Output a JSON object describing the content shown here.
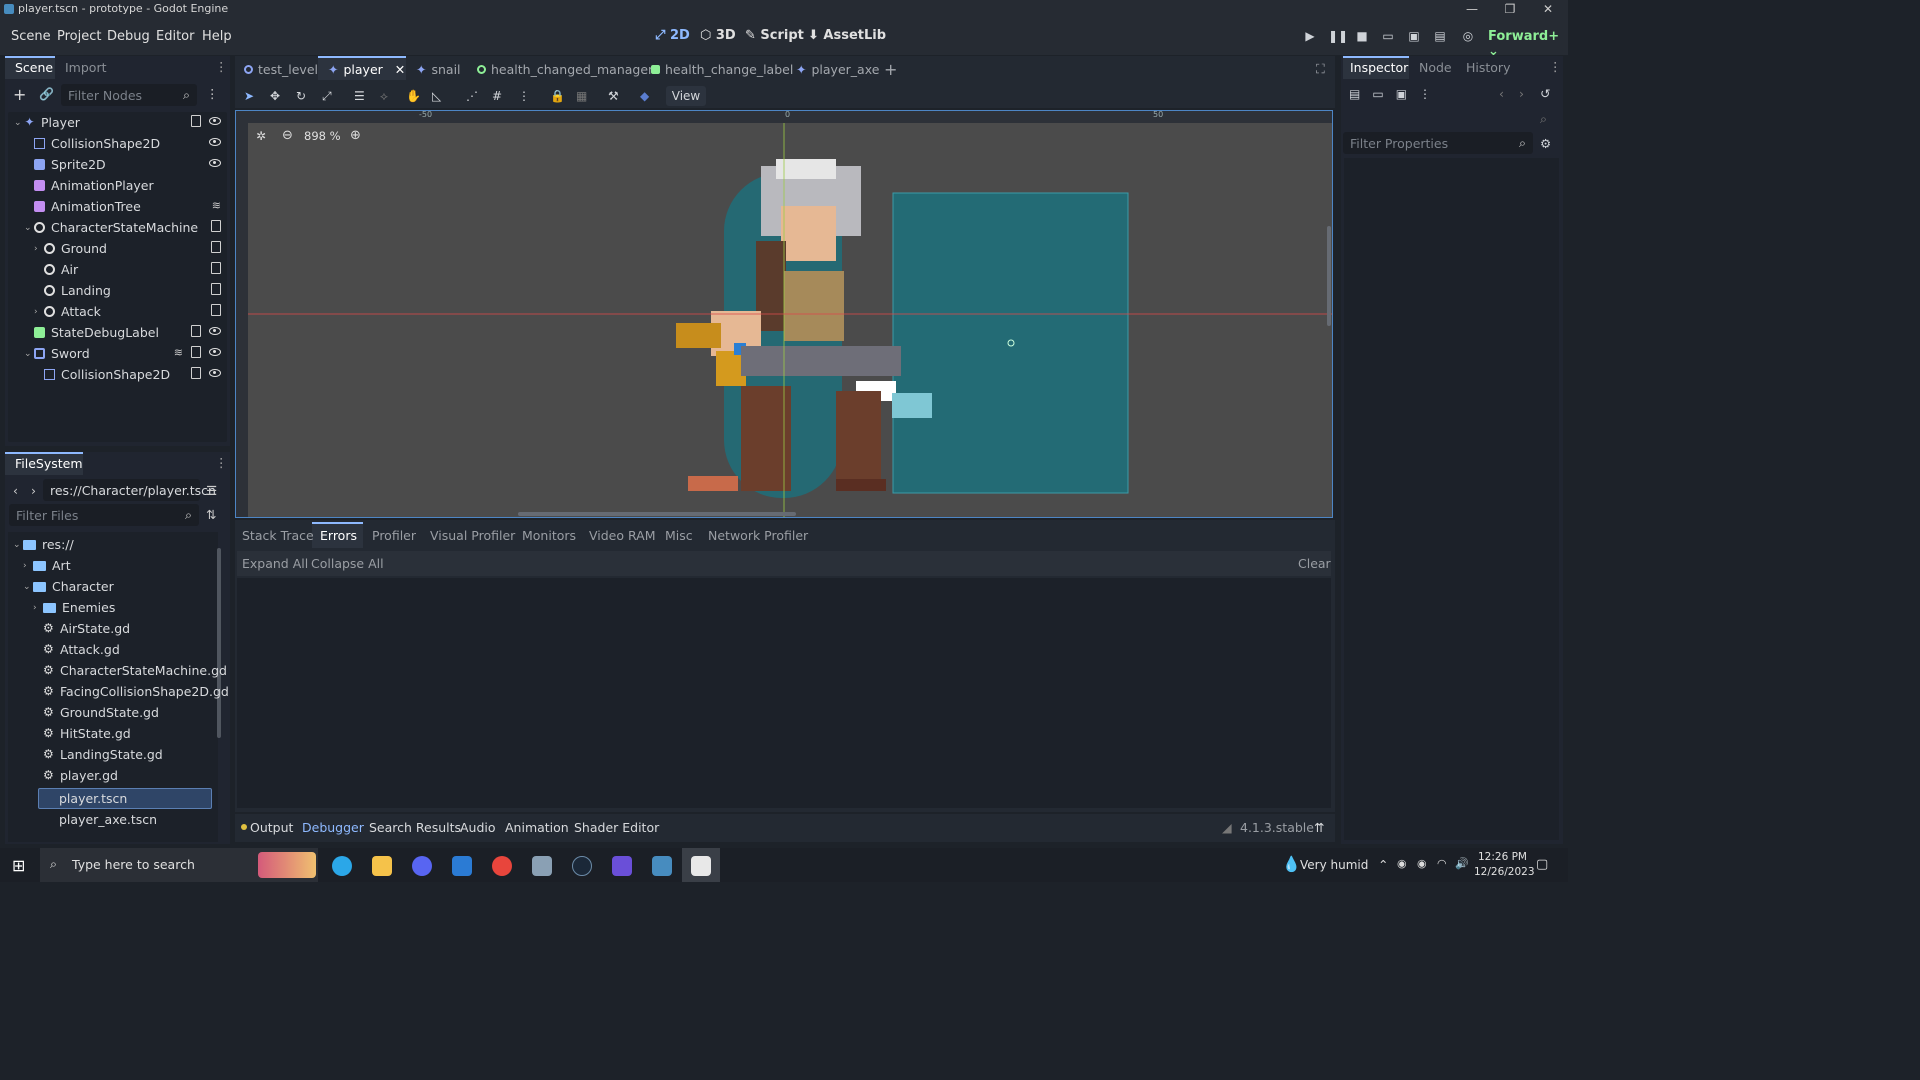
{
  "window": {
    "title": "player.tscn - prototype - Godot Engine",
    "controls": [
      "—",
      "❐",
      "✕"
    ]
  },
  "menus": [
    "Scene",
    "Project",
    "Debug",
    "Editor",
    "Help"
  ],
  "modes": {
    "m2d": "2D",
    "m3d": "3D",
    "script": "Script",
    "assetlib": "AssetLib"
  },
  "renderer": "Forward+",
  "scene_dock": {
    "tabs": [
      "Scene",
      "Import"
    ],
    "filter_placeholder": "Filter Nodes",
    "nodes": [
      {
        "label": "Player",
        "icon": "player-icon",
        "script": true,
        "visible": true
      },
      {
        "label": "CollisionShape2D",
        "icon": "collision-shape-icon",
        "script": false,
        "visible": true
      },
      {
        "label": "Sprite2D",
        "icon": "sprite-icon",
        "script": false,
        "visible": true
      },
      {
        "label": "AnimationPlayer",
        "icon": "animation-player-icon",
        "script": false,
        "visible": false
      },
      {
        "label": "AnimationTree",
        "icon": "animation-tree-icon",
        "script": false,
        "visible": false,
        "signal": true
      },
      {
        "label": "CharacterStateMachine",
        "icon": "node-icon",
        "script": true,
        "visible": false
      },
      {
        "label": "Ground",
        "icon": "node-icon",
        "script": true,
        "visible": false
      },
      {
        "label": "Air",
        "icon": "node-icon",
        "script": true,
        "visible": false
      },
      {
        "label": "Landing",
        "icon": "node-icon",
        "script": true,
        "visible": false
      },
      {
        "label": "Attack",
        "icon": "node-icon",
        "script": true,
        "visible": false
      },
      {
        "label": "StateDebugLabel",
        "icon": "label-icon",
        "script": true,
        "visible": true
      },
      {
        "label": "Sword",
        "icon": "area-icon",
        "script": true,
        "visible": true,
        "signal": true
      },
      {
        "label": "CollisionShape2D",
        "icon": "collision-shape-icon",
        "script": true,
        "visible": true
      }
    ]
  },
  "filesystem": {
    "tab": "FileSystem",
    "path": "res://Character/player.tscn",
    "filter_placeholder": "Filter Files",
    "items": [
      {
        "label": "res://",
        "type": "folder"
      },
      {
        "label": "Art",
        "type": "folder"
      },
      {
        "label": "Character",
        "type": "folder"
      },
      {
        "label": "Enemies",
        "type": "folder"
      },
      {
        "label": "AirState.gd",
        "type": "script"
      },
      {
        "label": "Attack.gd",
        "type": "script"
      },
      {
        "label": "CharacterStateMachine.gd",
        "type": "script"
      },
      {
        "label": "FacingCollisionShape2D.gd",
        "type": "script"
      },
      {
        "label": "GroundState.gd",
        "type": "script"
      },
      {
        "label": "HitState.gd",
        "type": "script"
      },
      {
        "label": "LandingState.gd",
        "type": "script"
      },
      {
        "label": "player.gd",
        "type": "script"
      },
      {
        "label": "player.tscn",
        "type": "scene"
      },
      {
        "label": "player_axe.tscn",
        "type": "scene"
      }
    ]
  },
  "editor_tabs": [
    {
      "label": "test_level",
      "icon": "node-icon"
    },
    {
      "label": "player",
      "icon": "player-icon",
      "active": true
    },
    {
      "label": "snail",
      "icon": "player-icon"
    },
    {
      "label": "health_changed_manager",
      "icon": "node-icon"
    },
    {
      "label": "health_change_label",
      "icon": "label-icon"
    },
    {
      "label": "player_axe",
      "icon": "player-icon"
    }
  ],
  "toolbar": {
    "view": "View"
  },
  "viewport": {
    "zoom": "898 %",
    "ruler_labels": [
      "-50",
      "0",
      "50"
    ]
  },
  "debugger": {
    "tabs": [
      "Stack Trace",
      "Errors",
      "Profiler",
      "Visual Profiler",
      "Monitors",
      "Video RAM",
      "Misc",
      "Network Profiler"
    ],
    "active_tab": "Errors",
    "expand_all": "Expand All",
    "collapse_all": "Collapse All",
    "clear": "Clear"
  },
  "bottom_panel": {
    "tabs": [
      "Output",
      "Debugger",
      "Search Results",
      "Audio",
      "Animation",
      "Shader Editor"
    ],
    "version": "4.1.3.stable"
  },
  "inspector": {
    "tabs": [
      "Inspector",
      "Node",
      "History"
    ],
    "filter_placeholder": "Filter Properties"
  },
  "taskbar": {
    "search_placeholder": "Type here to search",
    "weather": "Very humid",
    "time": "12:26 PM",
    "date": "12/26/2023"
  },
  "colors": {
    "accent": "#478cbf",
    "active_tab": "#8eb9ff",
    "collision_teal": "#1f6f7a"
  }
}
